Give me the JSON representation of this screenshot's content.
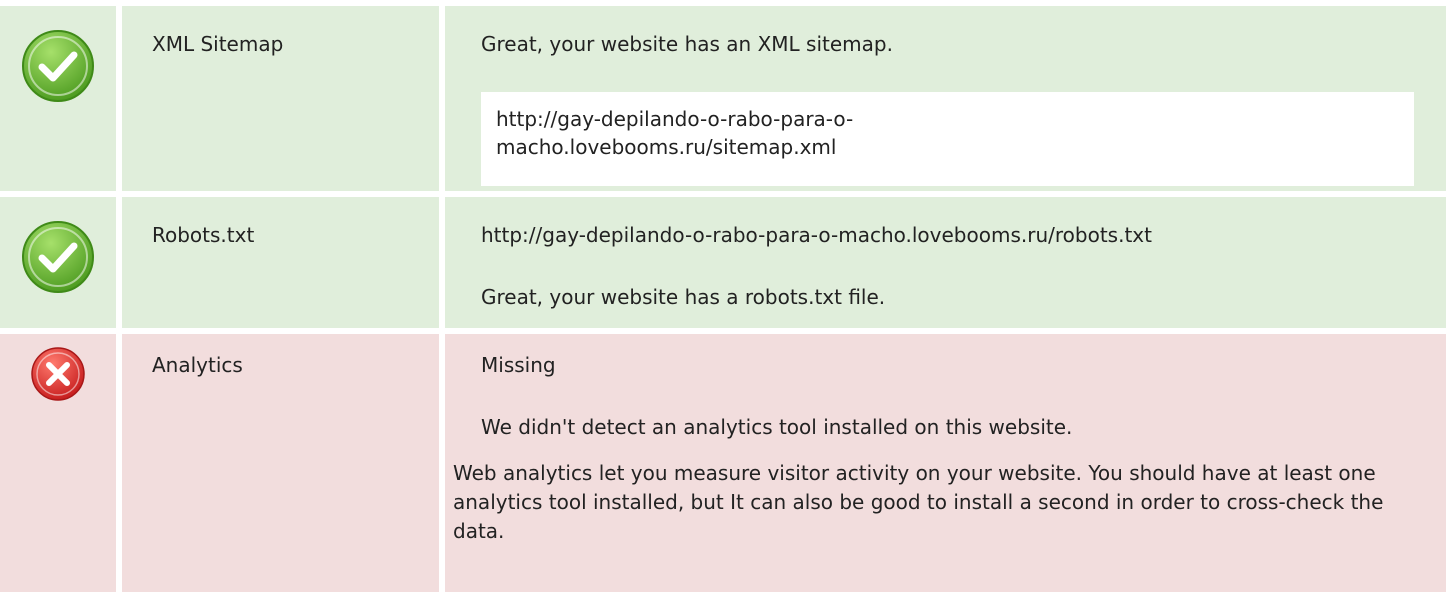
{
  "rows": [
    {
      "status": "pass",
      "icon": "check-icon",
      "label": "XML Sitemap",
      "message": "Great, your website has an XML sitemap.",
      "url_line1": "http://gay-depilando-o-rabo-para-o-",
      "url_line2": "macho.lovebooms.ru/sitemap.xml"
    },
    {
      "status": "pass",
      "icon": "check-icon",
      "label": "Robots.txt",
      "url": "http://gay-depilando-o-rabo-para-o-macho.lovebooms.ru/robots.txt",
      "message": "Great, your website has a robots.txt file."
    },
    {
      "status": "fail",
      "icon": "cross-icon",
      "label": "Analytics",
      "state": "Missing",
      "message": "We didn't detect an analytics tool installed on this website.",
      "description": "Web analytics let you measure visitor activity on your website. You should have at least one analytics tool installed, but It can also be good to install a second in order to cross-check the data."
    }
  ],
  "colors": {
    "pass_bg": "#e0eedb",
    "fail_bg": "#f2dddd",
    "pass_icon": "#6fbf3a",
    "fail_icon": "#e03a3a"
  }
}
